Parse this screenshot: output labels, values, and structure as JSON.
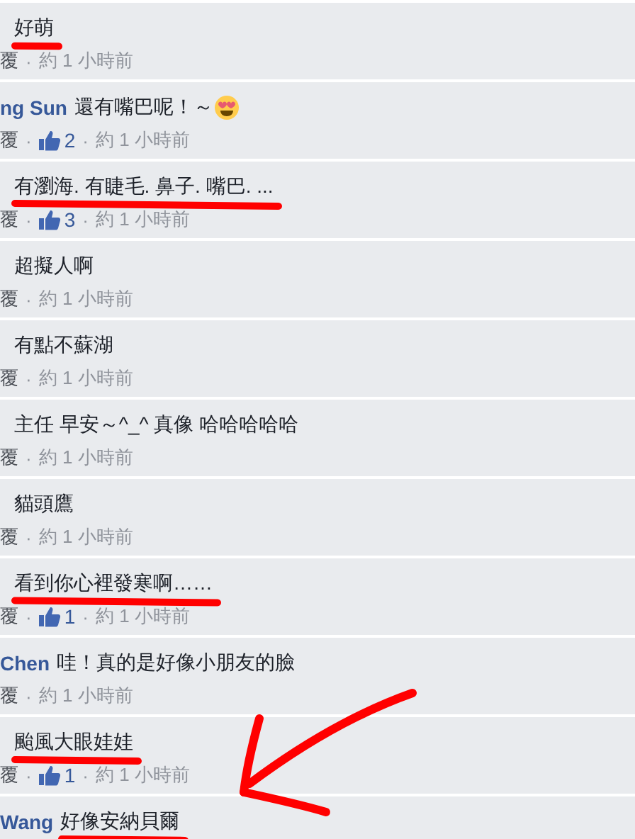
{
  "separator": "·",
  "comments": [
    {
      "text": "好萌",
      "underlined": true,
      "meta": {
        "reply": "覆",
        "time": "約 1 小時前"
      }
    },
    {
      "author": "ng Sun",
      "text": "還有嘴巴呢！～",
      "emoji_after": true,
      "meta": {
        "reply": "覆",
        "likes": "2",
        "time": "約 1 小時前"
      }
    },
    {
      "text": "有瀏海. 有睫毛. 鼻子. 嘴巴. ...",
      "underlined": true,
      "meta": {
        "reply": "覆",
        "likes": "3",
        "time": "約 1 小時前"
      }
    },
    {
      "text": "超擬人啊",
      "meta": {
        "reply": "覆",
        "time": "約 1 小時前"
      }
    },
    {
      "text": "有點不蘇湖",
      "meta": {
        "reply": "覆",
        "time": "約 1 小時前"
      }
    },
    {
      "text": "主任 早安～^_^ 真像 哈哈哈哈哈",
      "meta": {
        "reply": "覆",
        "time": "約 1 小時前"
      }
    },
    {
      "text": "貓頭鷹",
      "meta": {
        "reply": "覆",
        "time": "約 1 小時前"
      }
    },
    {
      "text": "看到你心裡發寒啊……",
      "underlined": true,
      "meta": {
        "reply": "覆",
        "likes": "1",
        "time": "約 1 小時前"
      }
    },
    {
      "author": "Chen",
      "text": "哇！真的是好像小朋友的臉",
      "meta": {
        "reply": "覆",
        "time": "約 1 小時前"
      }
    },
    {
      "text": "颱風大眼娃娃",
      "underlined": true,
      "meta": {
        "reply": "覆",
        "likes": "1",
        "time": "約 1 小時前"
      }
    },
    {
      "author": "Wang",
      "text": "好像安納貝爾",
      "underlined": true
    }
  ],
  "marker_arrow": true
}
